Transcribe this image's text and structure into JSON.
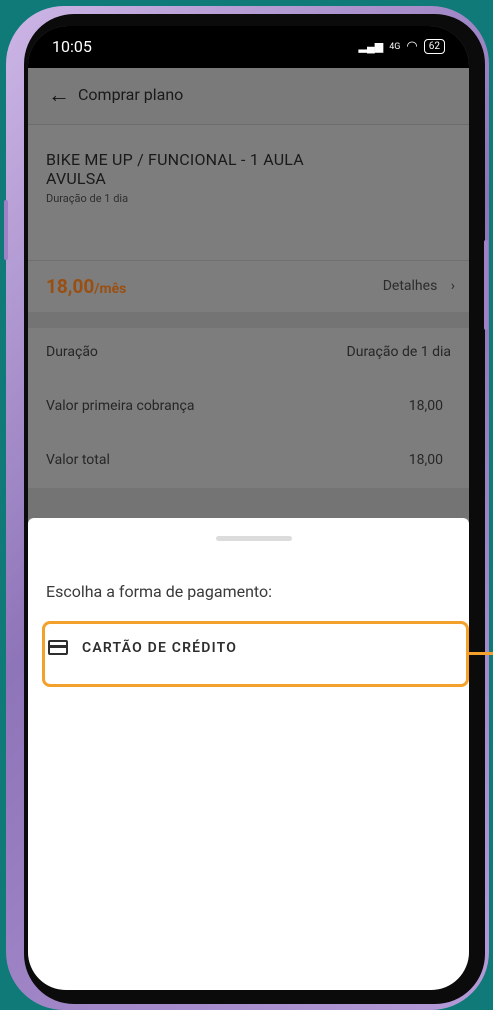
{
  "status_bar": {
    "time": "10:05",
    "network": "4G",
    "battery": "62"
  },
  "header": {
    "title": "Comprar plano"
  },
  "plan": {
    "name": "BIKE ME UP / FUNCIONAL - 1 AULA AVULSA",
    "duration": "Duração de 1 dia",
    "price": "18,00",
    "price_unit": "/mês",
    "details_label": "Detalhes"
  },
  "summary": [
    {
      "label": "Duração",
      "value": "Duração de 1 dia"
    },
    {
      "label": "Valor primeira cobrança",
      "value": "18,00"
    },
    {
      "label": "Valor total",
      "value": "18,00"
    }
  ],
  "sheet": {
    "title": "Escolha a forma de pagamento:",
    "options": [
      {
        "label": "CARTÃO DE CRÉDITO",
        "icon": "credit-card-icon"
      }
    ]
  },
  "colors": {
    "background": "#0f7a78",
    "accent_highlight": "#f3a12c",
    "price": "#9a4f12",
    "frame": "#b59ad8"
  }
}
